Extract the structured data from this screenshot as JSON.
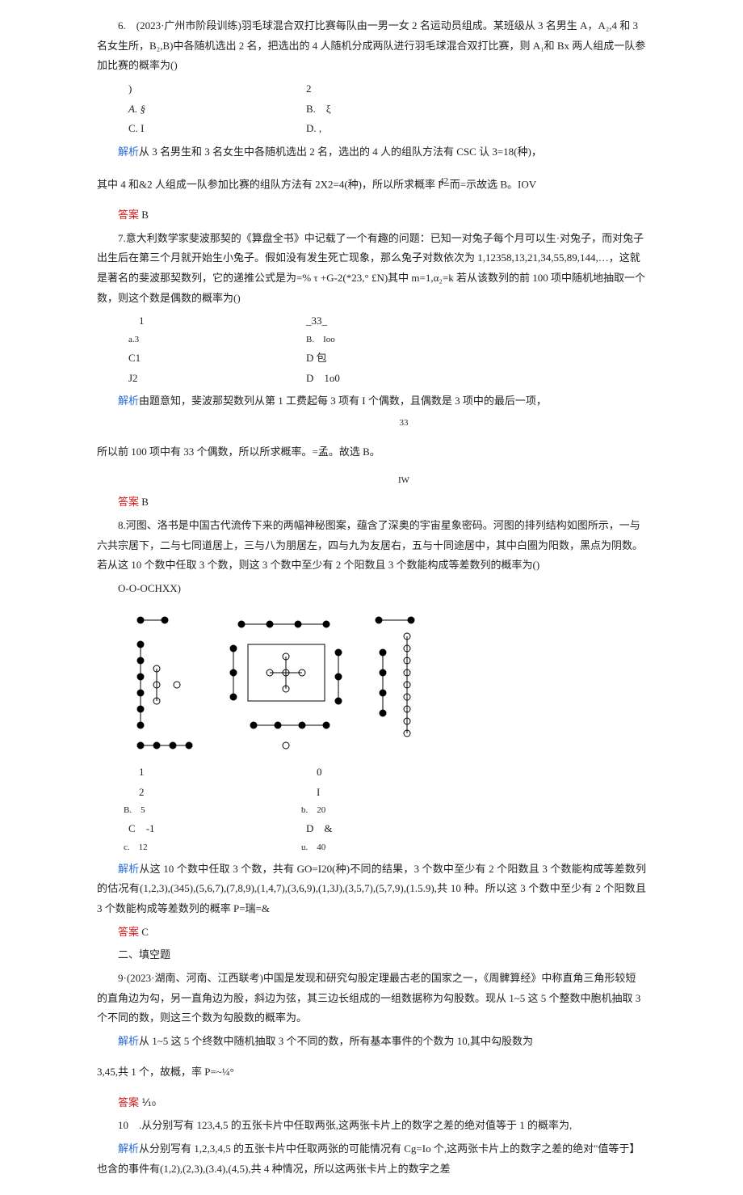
{
  "q6": {
    "text": "6.　(2023·广州市阶段训练)羽毛球混合双打比赛每队由一男一女 2 名运动员组成。某班级从 3 名男生 A，A₂,4 和 3 名女生所，B₂,B)中各随机选出 2 名，把选出的 4 人随机分成两队进行羽毛球混合双打比赛，则 A₁和 Bx 两人组成一队参加比赛的概率为()",
    "optA_l": ")",
    "optA": "A. §",
    "optB_l": "2",
    "optB": "B.　ξ",
    "optC": "C. I",
    "optD": "D. ,",
    "jiexi": "从 3 名男生和 3 名女生中各随机选出 2 名，选出的 4 人的组队方法有 CSC 认 3=18(种)，",
    "jiexi2": "其中 4 和&2 人组成一队参加比赛的组队方法有 2X2=4(种)，所以所求概率 P=而=示故选 B。IOV",
    "sup": "42",
    "ans": "B"
  },
  "q7": {
    "text": "7.意大利数学家斐波那契的《算盘全书》中记载了一个有趣的问题：已知一对兔子每个月可以生·对兔子，而对兔子出生后在第三个月就开始生小兔子。假如没有发生死亡现象，那么兔子对数依次为 1,12358,13,21,34,55,89,144,…，这就是著名的斐波那契数列，它的递推公式是为=% τ +G-2(*23,° £N)其中 m=1,α₂=k 若从该数列的前 100 项中随机地抽取一个数，则这个数是偶数的概率为()",
    "optA_u": "1",
    "optA_l": "3",
    "optA_pre": "a.",
    "optB_u": "_33_",
    "optB_l": "Ioo",
    "optB_pre": "B.",
    "optC": "C1",
    "optD_u": "D 包",
    "optC2": "J2",
    "optD_l": "D　1o0",
    "jiexi": "由题意知，斐波那契数列从第 1 工费起每 3 项有 I 个偶数，且偶数是 3 项中的最后一项，",
    "jiexi2a": "所以前 100 项中有 33 个偶数，所以所求概率。=孟。故选 B。",
    "frac_top": "33",
    "frac_bot": "IW",
    "ans": "B"
  },
  "q8": {
    "text": "8.河图、洛书是中国古代流传下来的两幅神秘图案，蕴含了深奥的宇宙星象密码。河图的排列结构如图所示，一与六共宗居下，二与七同道居上，三与八为朋居左，四与九为友居右，五与十同途居中，其中白圈为阳数，黑点为阴数。若从这 10 个数中任取 3 个数，则这 3 个数中至少有 2 个阳数且 3 个数能构成等差数列的概率为()",
    "fig_label": "O-O-OCHXX)",
    "optA_u": "1",
    "optA_l": "2",
    "optA_ll": "5",
    "optA_pre": "B.",
    "optB_u": "0",
    "optB_l": "I",
    "optB_ll": "20",
    "optB_pre": "b.",
    "optC_u": "C",
    "optC_l": "c.",
    "optC_v1": "-1",
    "optC_v2": "12",
    "optD_u": "D",
    "optD_l": "u.",
    "optD_v1": "&",
    "optD_v2": "40",
    "jiexi": "从这 10 个数中任取 3 个数，共有 GO=I20(种)不同的结果，3 个数中至少有 2 个阳数且 3 个数能构成等差数列的估况有(1,2,3),(345),(5,6,7),(7,8,9),(1,4,7),(3,6,9),(1,3J),(3,5,7),(5,7,9),(1.5.9),共 10 种。所以这 3 个数中至少有 2 个阳数且 3 个数能构成等差数列的概率 P=瑞=&",
    "ans": "C"
  },
  "sec2": "二、填空题",
  "q9": {
    "text": "9·(2023·湖南、河南、江西联考)中国是发现和研究勾股定理最古老的国家之一，《周髀算经》中称直角三角形较短的直角边为勾，另一直角边为股，斜边为弦，其三边长组成的一组数据称为勾股数。现从 1~5 这 5 个整数中胞机抽取 3 个不同的数，则这三个数为勾股数的概率为。",
    "jiexi": "从 1~5 这 5 个终数中随机抽取 3 个不同的数，所有基本事件的个数为 10,其中勾股数为",
    "jiexi2": "3,45,共 1 个，故概，率 P=~¼°",
    "ans": "⅒"
  },
  "q10": {
    "text": "10　.从分别写有 123,4,5 的五张卡片中任取两张,这两张卡片上的数字之差的绝对值等于 1 的概率为,",
    "jiexi": "从分别写有 1,2,3,4,5 的五张卡片中任取两张的可能情况有 Cg=Io 个,这两张卡片上的数字之差的绝对\"值等于】也含的事件有(1,2),(2,3),(3.4),(4,5),共 4 种情况，所以这两张卡片上的数字之差"
  },
  "labels": {
    "jiexi": "解析",
    "daan": "答案"
  }
}
